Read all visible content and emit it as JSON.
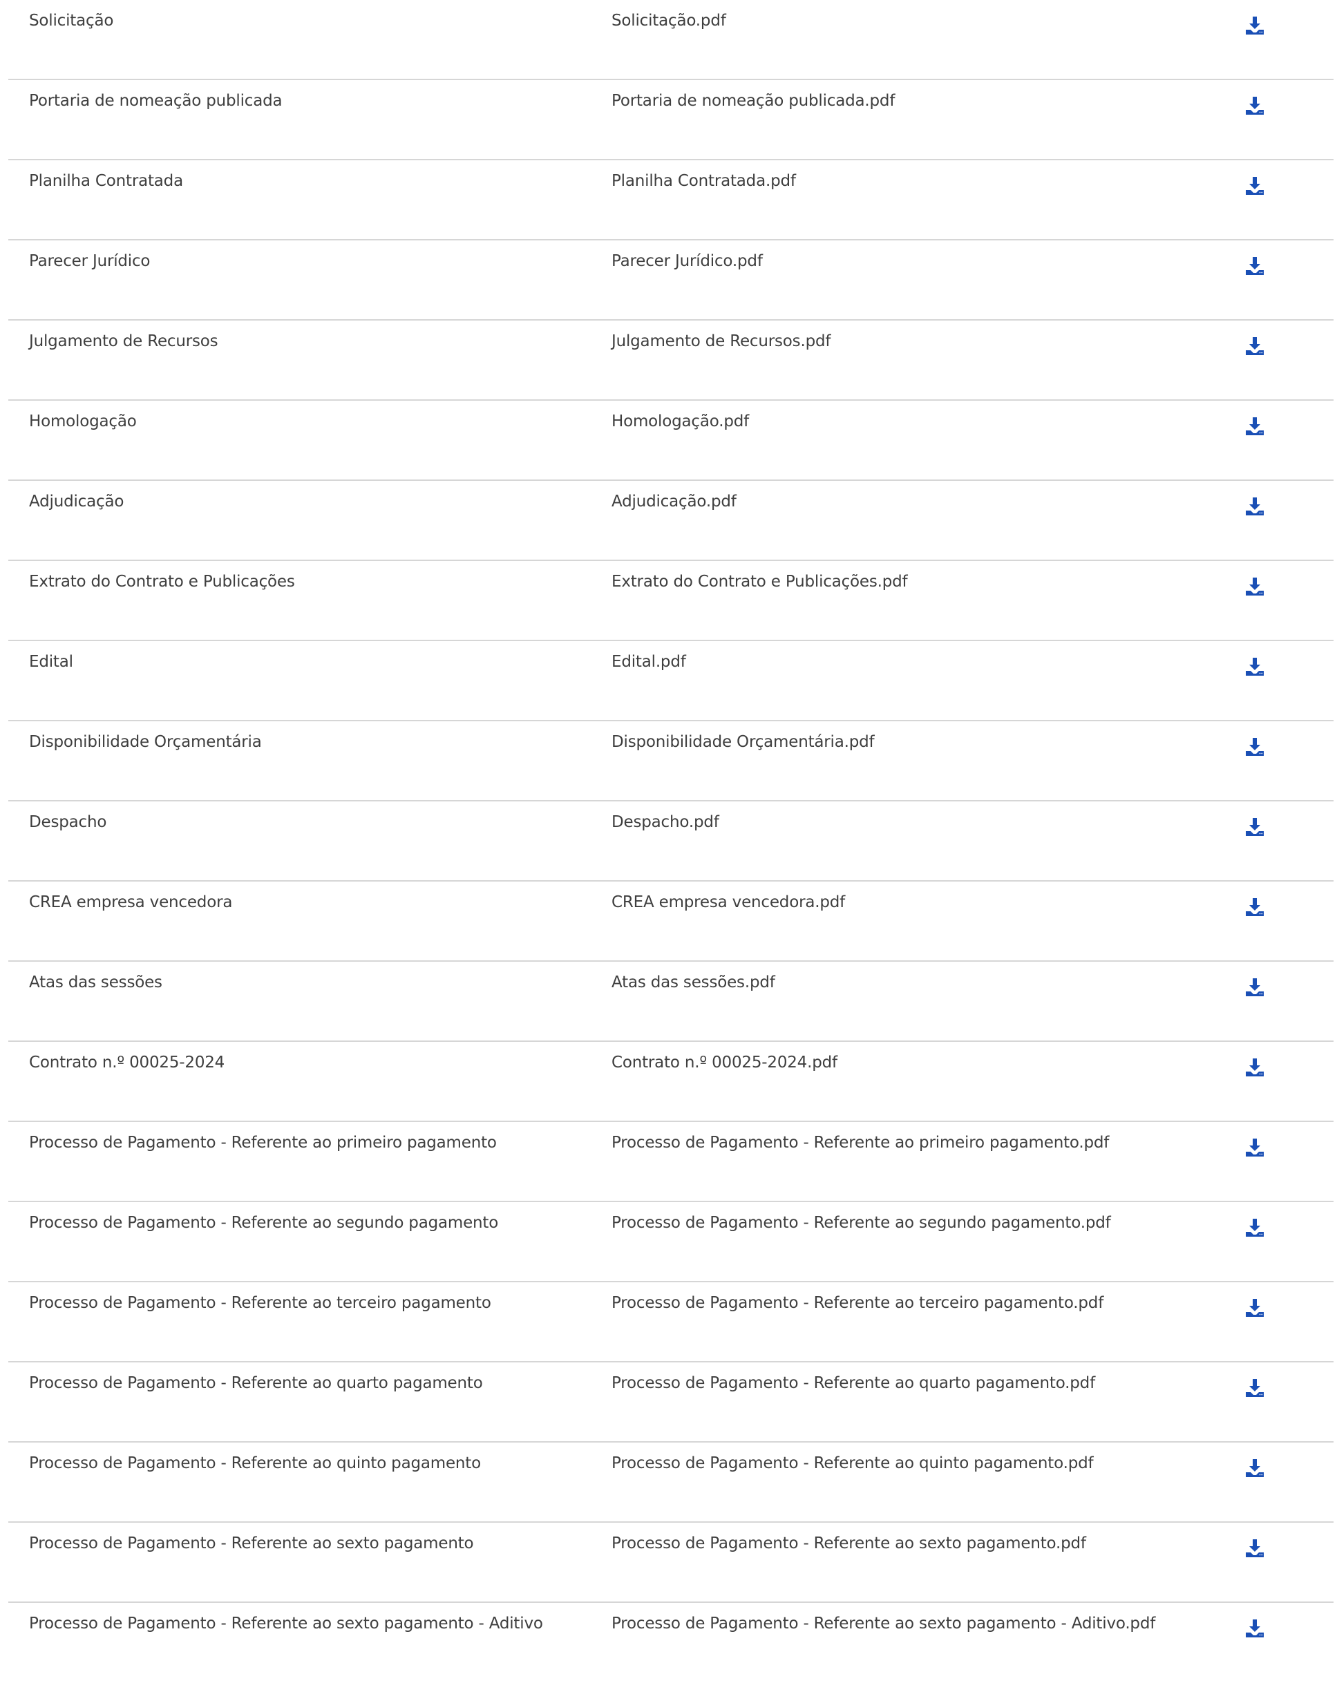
{
  "theme": {
    "icon_color": "#1a4fb5",
    "text_color": "#3f3f3f",
    "divider_color": "#d6d6d6"
  },
  "documents": {
    "rows": [
      {
        "name": "Solicitação",
        "file": "Solicitação.pdf",
        "action_icon": "download-icon"
      },
      {
        "name": "Portaria de nomeação publicada",
        "file": "Portaria de nomeação publicada.pdf",
        "action_icon": "download-icon"
      },
      {
        "name": "Planilha Contratada",
        "file": "Planilha Contratada.pdf",
        "action_icon": "download-icon"
      },
      {
        "name": "Parecer Jurídico",
        "file": "Parecer Jurídico.pdf",
        "action_icon": "download-icon"
      },
      {
        "name": "Julgamento de Recursos",
        "file": "Julgamento de Recursos.pdf",
        "action_icon": "download-icon"
      },
      {
        "name": "Homologação",
        "file": "Homologação.pdf",
        "action_icon": "download-icon"
      },
      {
        "name": "Adjudicação",
        "file": "Adjudicação.pdf",
        "action_icon": "download-icon"
      },
      {
        "name": "Extrato do Contrato e Publicações",
        "file": "Extrato do Contrato e Publicações.pdf",
        "action_icon": "download-icon"
      },
      {
        "name": "Edital",
        "file": "Edital.pdf",
        "action_icon": "download-icon"
      },
      {
        "name": "Disponibilidade Orçamentária",
        "file": "Disponibilidade Orçamentária.pdf",
        "action_icon": "download-icon"
      },
      {
        "name": "Despacho",
        "file": "Despacho.pdf",
        "action_icon": "download-icon"
      },
      {
        "name": "CREA empresa vencedora",
        "file": "CREA empresa vencedora.pdf",
        "action_icon": "download-icon"
      },
      {
        "name": "Atas das sessões",
        "file": "Atas das sessões.pdf",
        "action_icon": "download-icon"
      },
      {
        "name": "Contrato n.º 00025-2024",
        "file": "Contrato n.º 00025-2024.pdf",
        "action_icon": "download-icon"
      },
      {
        "name": "Processo de Pagamento - Referente ao primeiro pagamento",
        "file": "Processo de Pagamento - Referente ao primeiro pagamento.pdf",
        "action_icon": "download-icon"
      },
      {
        "name": "Processo de Pagamento - Referente ao segundo pagamento",
        "file": "Processo de Pagamento - Referente ao segundo pagamento.pdf",
        "action_icon": "download-icon"
      },
      {
        "name": "Processo de Pagamento - Referente ao terceiro pagamento",
        "file": "Processo de Pagamento - Referente ao terceiro pagamento.pdf",
        "action_icon": "download-icon"
      },
      {
        "name": "Processo de Pagamento - Referente ao quarto pagamento",
        "file": "Processo de Pagamento - Referente ao quarto pagamento.pdf",
        "action_icon": "download-icon"
      },
      {
        "name": "Processo de Pagamento - Referente ao quinto pagamento",
        "file": "Processo de Pagamento - Referente ao quinto pagamento.pdf",
        "action_icon": "download-icon"
      },
      {
        "name": "Processo de Pagamento - Referente ao sexto pagamento",
        "file": "Processo de Pagamento - Referente ao sexto pagamento.pdf",
        "action_icon": "download-icon"
      },
      {
        "name": "Processo de Pagamento - Referente ao sexto pagamento - Aditivo",
        "file": "Processo de Pagamento - Referente ao sexto pagamento - Aditivo.pdf",
        "action_icon": "download-icon"
      }
    ]
  }
}
